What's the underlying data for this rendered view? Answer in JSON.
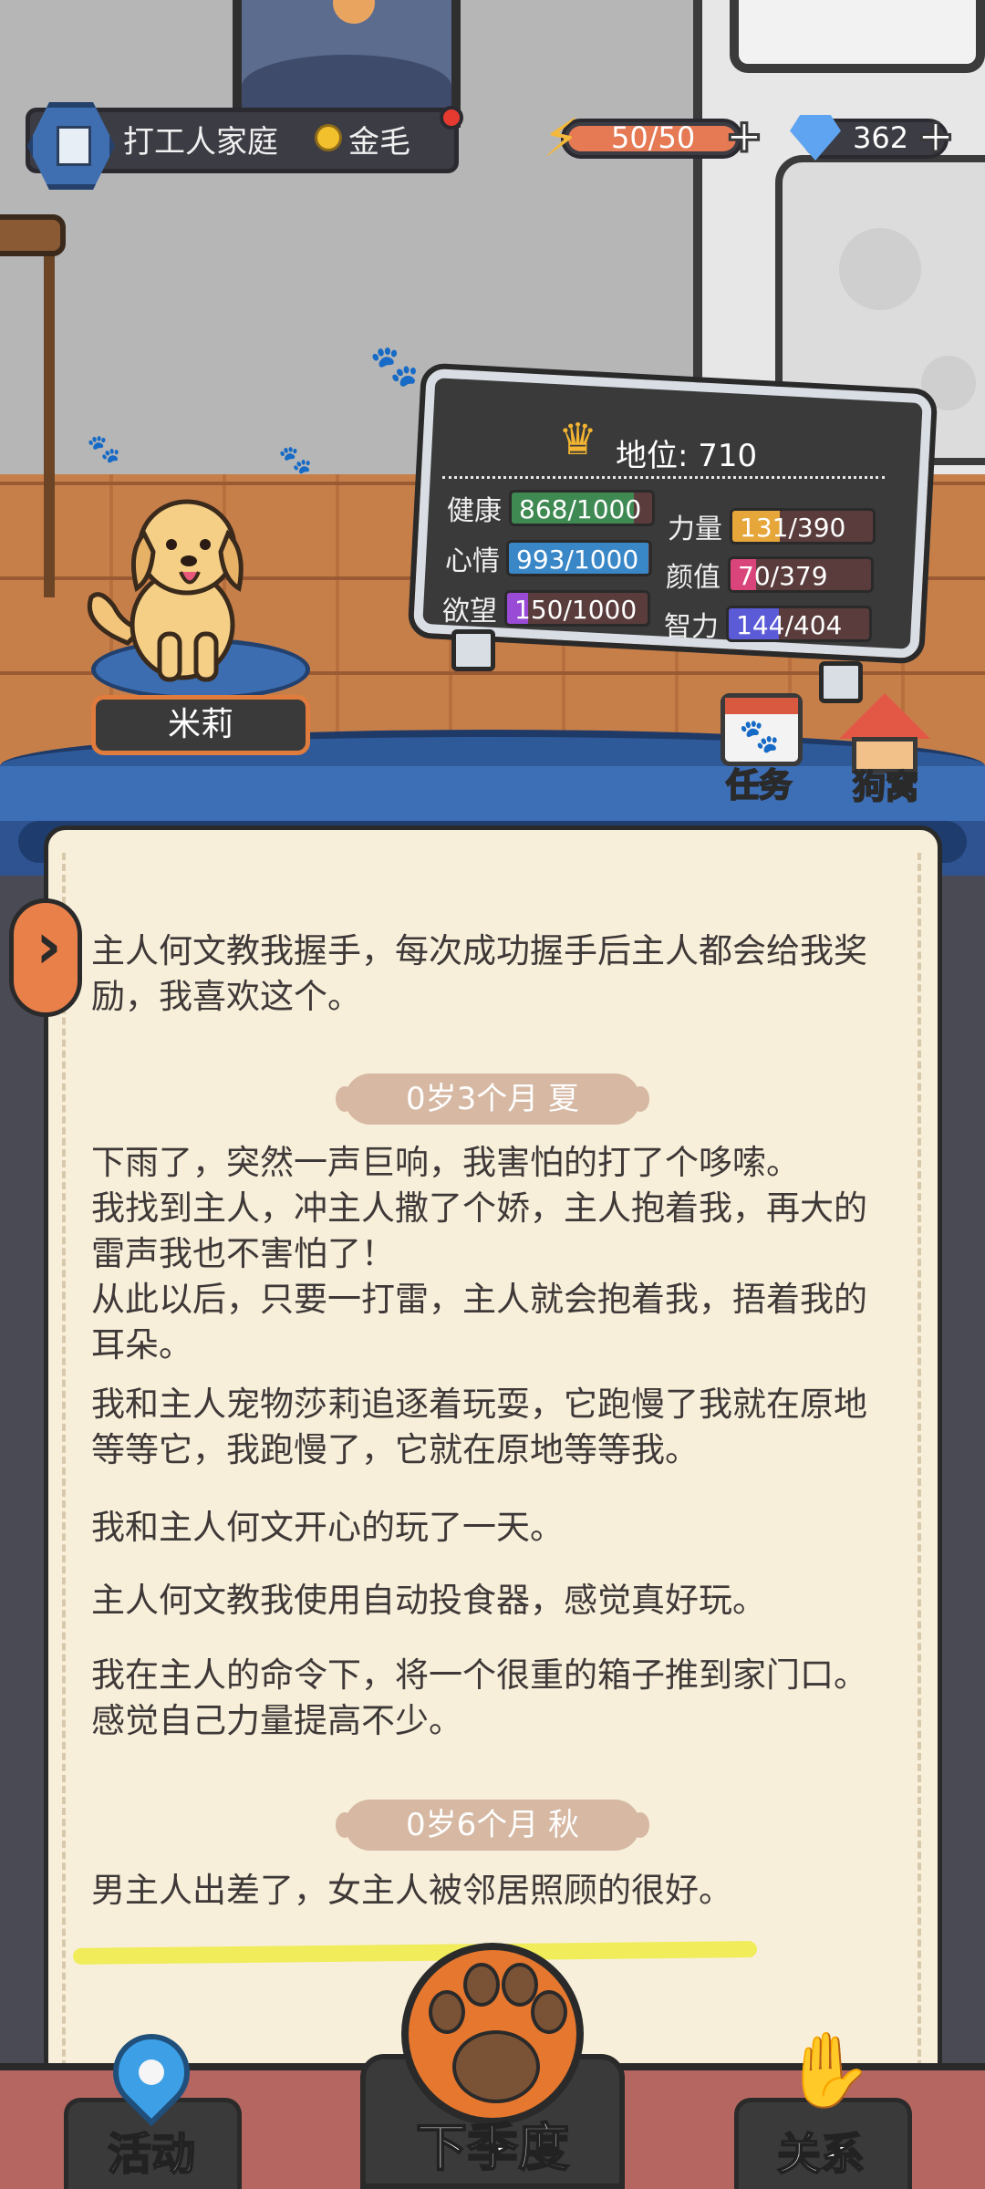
{
  "header": {
    "family_name": "打工人家庭",
    "breed": "金毛",
    "energy": {
      "current": 50,
      "max": 50,
      "label": "50/50",
      "fill_fraction": 1.0
    },
    "gems": "362",
    "icons": {
      "family": "building-icon",
      "breed": "medal-icon",
      "energy": "lightning-icon",
      "gem": "diamond-icon",
      "add": "plus-icon"
    }
  },
  "pet": {
    "name": "米莉"
  },
  "status_board": {
    "rank_label": "地位: 710",
    "stats": [
      {
        "name": "健康",
        "value": "868/1000",
        "fraction": 0.868,
        "color": "#3f8a52"
      },
      {
        "name": "力量",
        "value": "131/390",
        "fraction": 0.336,
        "color": "#e6a63a"
      },
      {
        "name": "心情",
        "value": "993/1000",
        "fraction": 0.993,
        "color": "#3a87c8"
      },
      {
        "name": "颜值",
        "value": "70/379",
        "fraction": 0.185,
        "color": "#d9457a"
      },
      {
        "name": "欲望",
        "value": "150/1000",
        "fraction": 0.15,
        "color": "#9a4bd6"
      },
      {
        "name": "智力",
        "value": "144/404",
        "fraction": 0.356,
        "color": "#5b5bd8"
      }
    ]
  },
  "side_buttons": {
    "task": "任务",
    "kennel": "狗窝"
  },
  "diary": {
    "entries": [
      {
        "type": "text",
        "text": "主人何文教我握手，每次成功握手后主人都会给我奖励，我喜欢这个。"
      },
      {
        "type": "season",
        "text": "0岁3个月 夏"
      },
      {
        "type": "text",
        "text": "下雨了，突然一声巨响，我害怕的打了个哆嗦。\n我找到主人，冲主人撒了个娇，主人抱着我，再大的雷声我也不害怕了！\n从此以后，只要一打雷，主人就会抱着我，捂着我的耳朵。"
      },
      {
        "type": "text",
        "text": "我和主人宠物莎莉追逐着玩耍，它跑慢了我就在原地等等它，我跑慢了，它就在原地等等我。"
      },
      {
        "type": "text",
        "text": "我和主人何文开心的玩了一天。"
      },
      {
        "type": "text",
        "text": "主人何文教我使用自动投食器，感觉真好玩。"
      },
      {
        "type": "text",
        "text": "我在主人的命令下，将一个很重的箱子推到家门口。\n感觉自己力量提高不少。"
      },
      {
        "type": "season",
        "text": "0岁6个月 秋"
      },
      {
        "type": "text",
        "text": "男主人出差了，女主人被邻居照顾的很好。"
      }
    ]
  },
  "bottom_nav": {
    "activity": "活动",
    "next_season": "下季度",
    "relation": "关系"
  }
}
